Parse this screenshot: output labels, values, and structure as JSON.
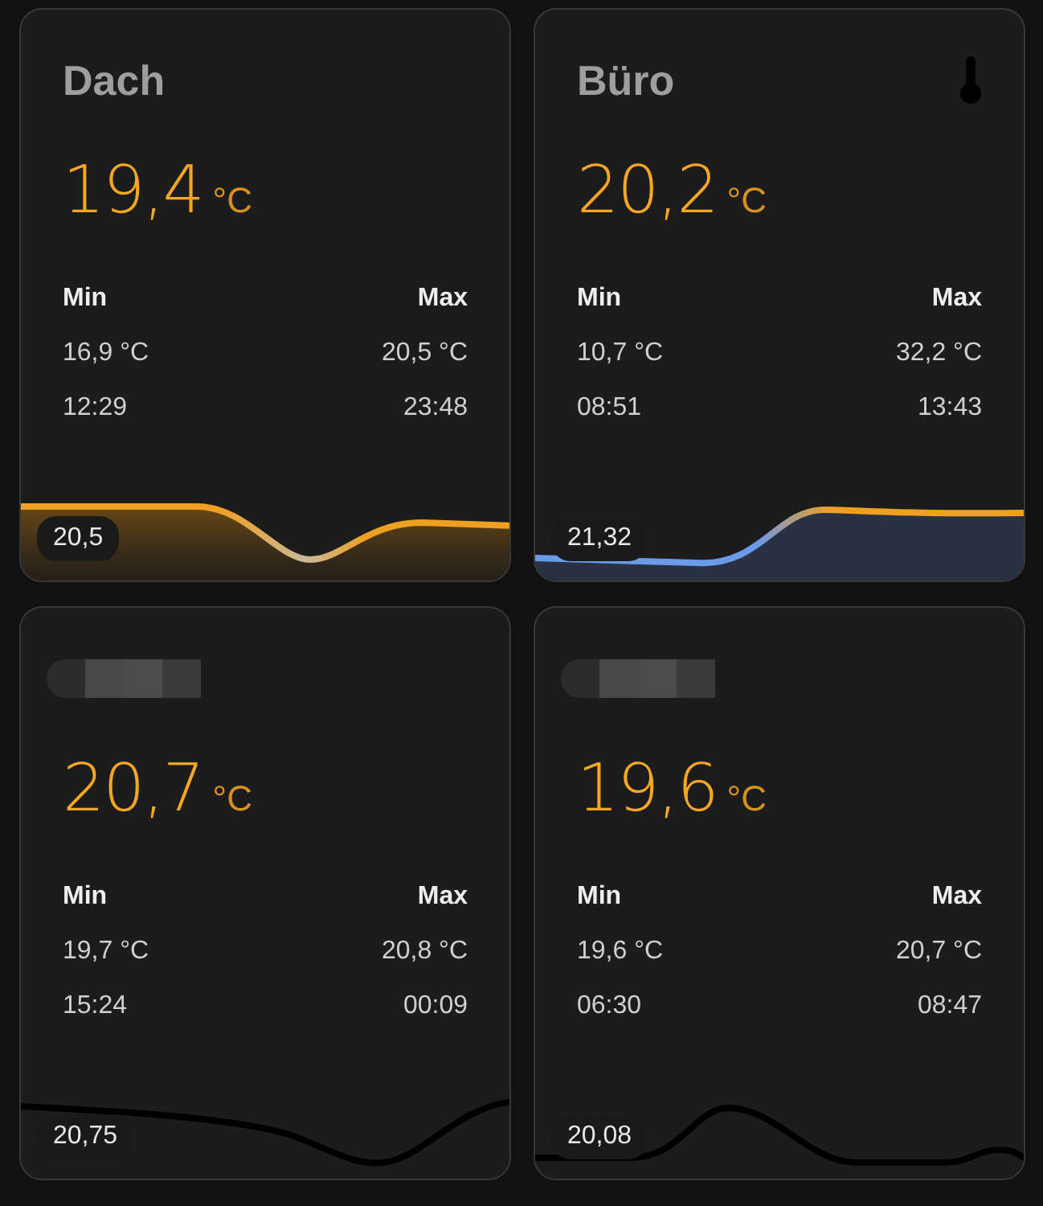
{
  "cards": [
    {
      "title": "Dach",
      "title_hidden": false,
      "show_icon": false,
      "value": "19,4",
      "unit": "°C",
      "min_label": "Min",
      "max_label": "Max",
      "min_value": "16,9 °C",
      "max_value": "20,5 °C",
      "min_time": "12:29",
      "max_time": "23:48",
      "kind": "warm",
      "badge": "20,5"
    },
    {
      "title": "Büro",
      "title_hidden": false,
      "show_icon": true,
      "value": "20,2",
      "unit": "°C",
      "min_label": "Min",
      "max_label": "Max",
      "min_value": "10,7 °C",
      "max_value": "32,2 °C",
      "min_time": "08:51",
      "max_time": "13:43",
      "kind": "cool",
      "badge": "21,32"
    },
    {
      "title_hidden": true,
      "show_icon": false,
      "value": "20,7",
      "unit": "°C",
      "min_label": "Min",
      "max_label": "Max",
      "min_value": "19,7 °C",
      "max_value": "20,8 °C",
      "min_time": "15:24",
      "max_time": "00:09",
      "kind": "dark",
      "badge": "20,75"
    },
    {
      "title_hidden": true,
      "show_icon": false,
      "value": "19,6",
      "unit": "°C",
      "min_label": "Min",
      "max_label": "Max",
      "min_value": "19,6 °C",
      "max_value": "20,7 °C",
      "min_time": "06:30",
      "max_time": "08:47",
      "kind": "dark",
      "badge": "20,08"
    }
  ]
}
